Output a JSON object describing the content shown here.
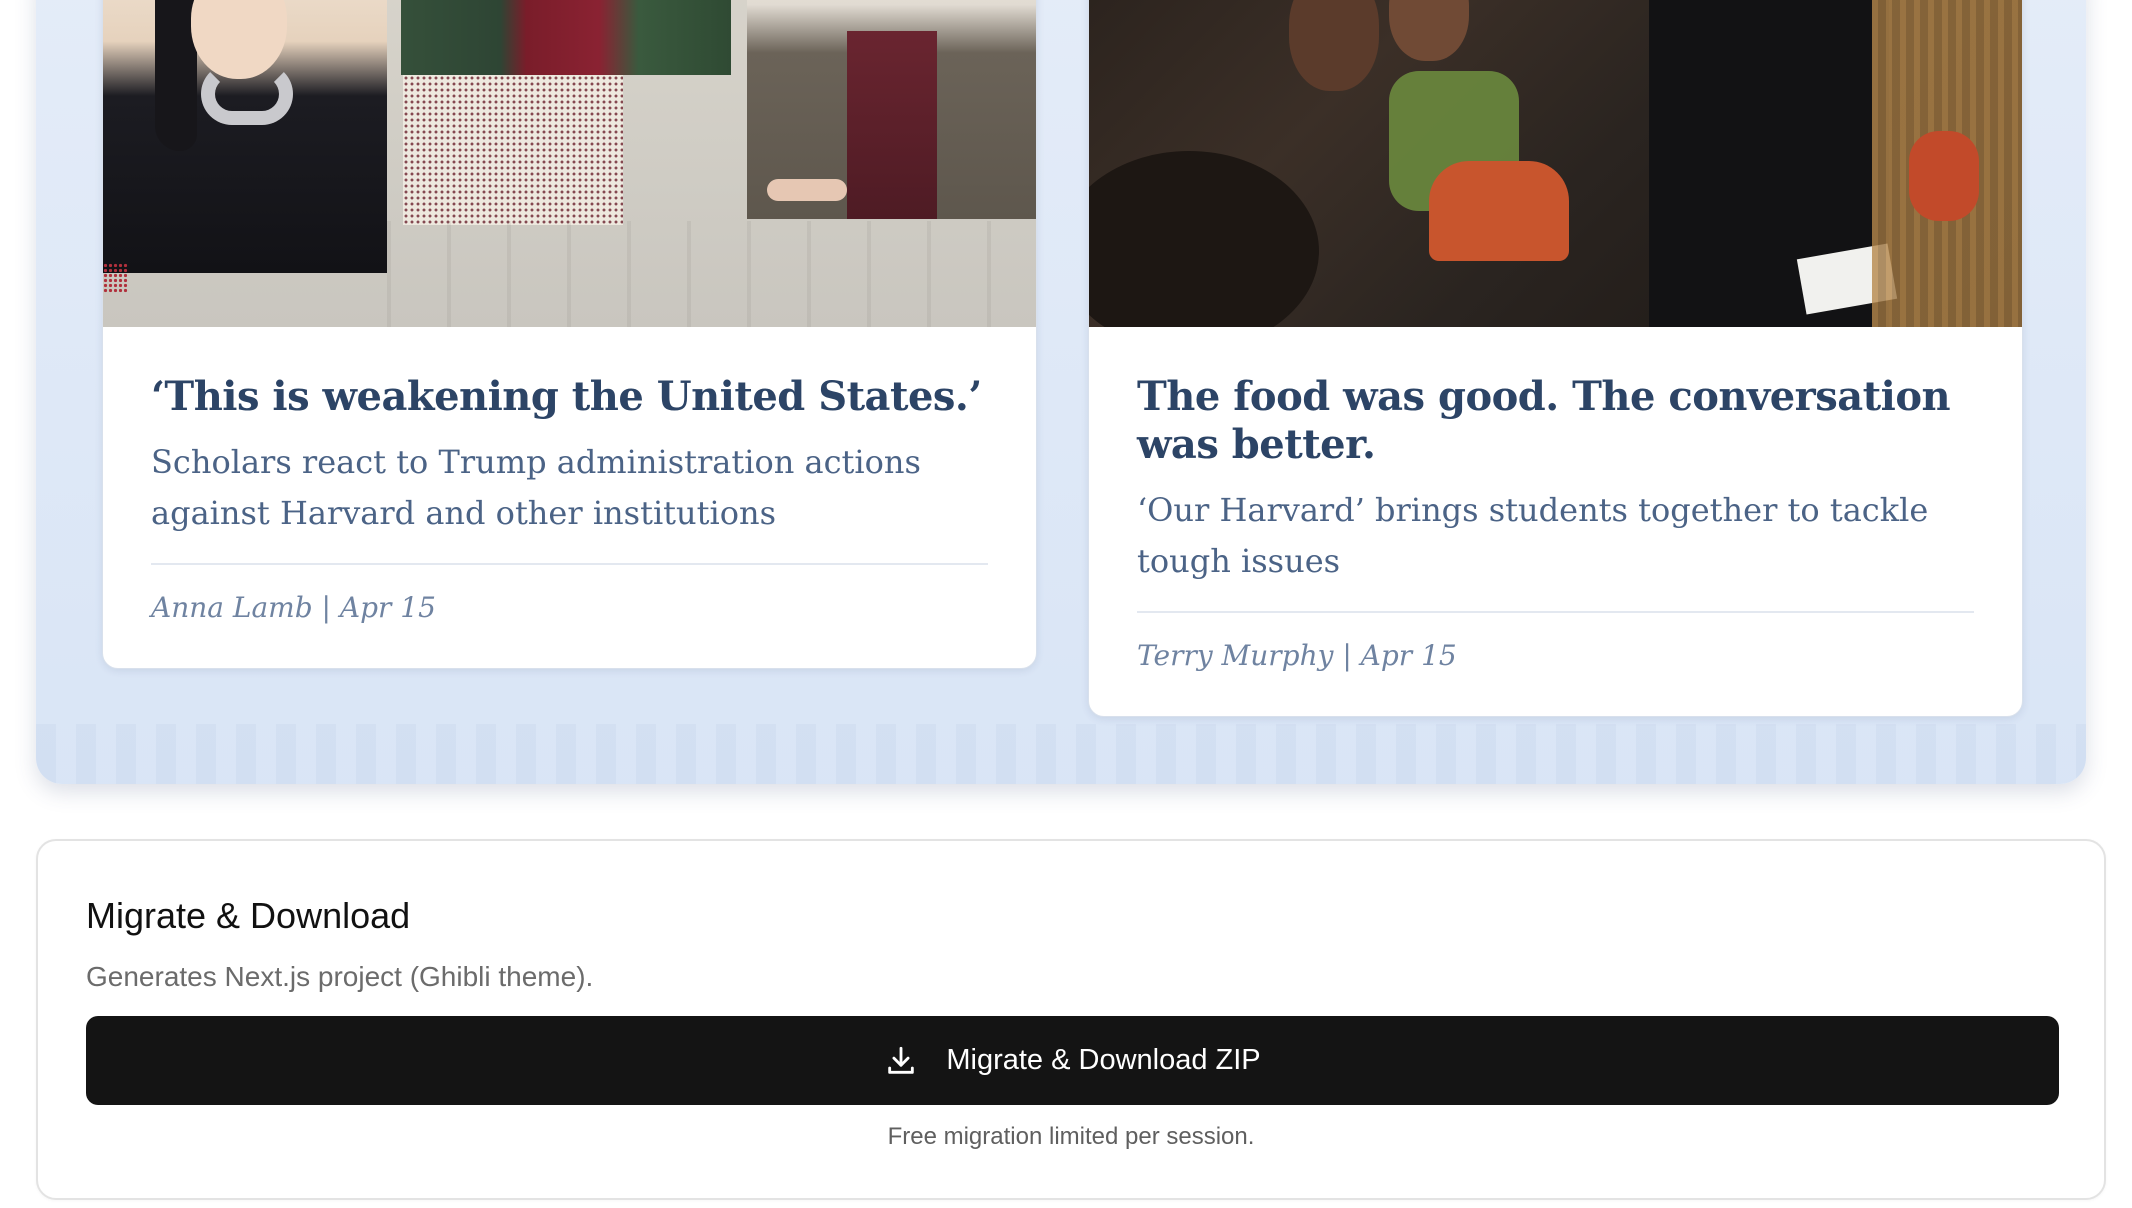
{
  "preview": {
    "articles": [
      {
        "title": "‘This is weakening the United States.’",
        "subtitle": "Scholars react to Trump administration actions against Harvard and other institutions",
        "meta": "Anna Lamb | Apr 15"
      },
      {
        "title": "The food was good. The conversation was better.",
        "subtitle": "‘Our Harvard’ brings students together to tackle tough issues",
        "meta": "Terry Murphy | Apr 15"
      }
    ]
  },
  "migrate": {
    "title": "Migrate & Download",
    "description": "Generates Next.js project (Ghibli theme).",
    "button_label": "Migrate & Download ZIP",
    "button_icon": "download-icon",
    "note": "Free migration limited per session."
  },
  "colors": {
    "panel_bg": "#dde7f6",
    "title": "#2c4466",
    "subtitle": "#4b6386",
    "meta": "#6f83a1",
    "button_bg": "#141414"
  }
}
